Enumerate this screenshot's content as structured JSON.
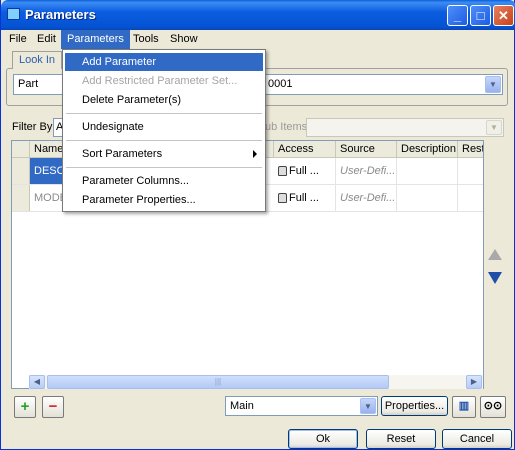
{
  "window": {
    "title": "Parameters"
  },
  "menubar": {
    "items": [
      "File",
      "Edit",
      "Parameters",
      "Tools",
      "Show"
    ],
    "active": "Parameters"
  },
  "lookin": {
    "label": "Look In",
    "type_value": "Part",
    "object_value": "0001"
  },
  "filter": {
    "label": "Filter By",
    "value": "A",
    "subitems_label": "ub Items"
  },
  "grid": {
    "columns": [
      "Name",
      "Access",
      "Source",
      "Description",
      "Rest"
    ],
    "rows": [
      {
        "name": "DESC",
        "access": "Full",
        "source": "User-Defi..."
      },
      {
        "name": "MODE",
        "access": "Full",
        "source": "User-Defi..."
      }
    ]
  },
  "dropdown": {
    "items": [
      {
        "label": "Add Parameter",
        "state": "highlighted"
      },
      {
        "label": "Add Restricted Parameter Set...",
        "state": "disabled"
      },
      {
        "label": "Delete Parameter(s)",
        "state": "normal"
      },
      {
        "label": "Undesignate",
        "state": "normal"
      },
      {
        "label": "Sort Parameters",
        "state": "submenu"
      },
      {
        "label": "Parameter Columns...",
        "state": "normal"
      },
      {
        "label": "Parameter Properties...",
        "state": "normal"
      }
    ]
  },
  "bottom": {
    "table_select": "Main",
    "properties_label": "Properties...",
    "ok_label": "Ok",
    "reset_label": "Reset",
    "cancel_label": "Cancel"
  },
  "colors": {
    "title_blue": "#0553d4",
    "highlight": "#316ac5",
    "add_green": "#27a12a",
    "remove_red": "#d32626"
  }
}
